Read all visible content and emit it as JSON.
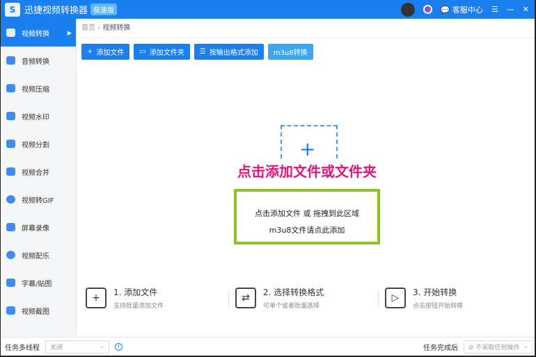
{
  "app": {
    "logo_text": "S",
    "title": "迅捷视频转换器",
    "badge": "极速版",
    "service": "客服中心",
    "menu_icon": "☰",
    "minimize": "—",
    "close": "✕"
  },
  "sidebar": {
    "items": [
      {
        "label": "视频转换",
        "active": true
      },
      {
        "label": "音频转换"
      },
      {
        "label": "视频压缩"
      },
      {
        "label": "视频水印"
      },
      {
        "label": "视频分割"
      },
      {
        "label": "视频合并"
      },
      {
        "label": "视频转GIF"
      },
      {
        "label": "屏幕录像"
      },
      {
        "label": "视频配乐"
      },
      {
        "label": "字幕/贴图"
      },
      {
        "label": "视频截图"
      }
    ]
  },
  "breadcrumb": {
    "home": "首页",
    "sep": "›",
    "current": "视频转换"
  },
  "toolbar": {
    "add_file": "添加文件",
    "add_folder": "添加文件夹",
    "by_format": "按输出格式添加",
    "m3u8": "m3u8转换"
  },
  "drop": {
    "plus": "+",
    "headline": "点击添加文件或文件夹",
    "line1": "点击添加文件 或 拖拽到此区域",
    "line2": "m3u8文件请点此添加"
  },
  "steps": [
    {
      "icon": "+",
      "title": "1. 添加文件",
      "desc": "支持批量添加文件"
    },
    {
      "icon": "⇄",
      "title": "2. 选择转换格式",
      "desc": "可单个或者批量选择"
    },
    {
      "icon": "▷",
      "title": "3. 开始转换",
      "desc": "点击按钮开始转换"
    }
  ],
  "bottom": {
    "multithread_label": "任务多线程",
    "multithread_value": "关闭",
    "info": "!",
    "after_label": "任务完成后",
    "after_value": "不采取任何操作"
  }
}
